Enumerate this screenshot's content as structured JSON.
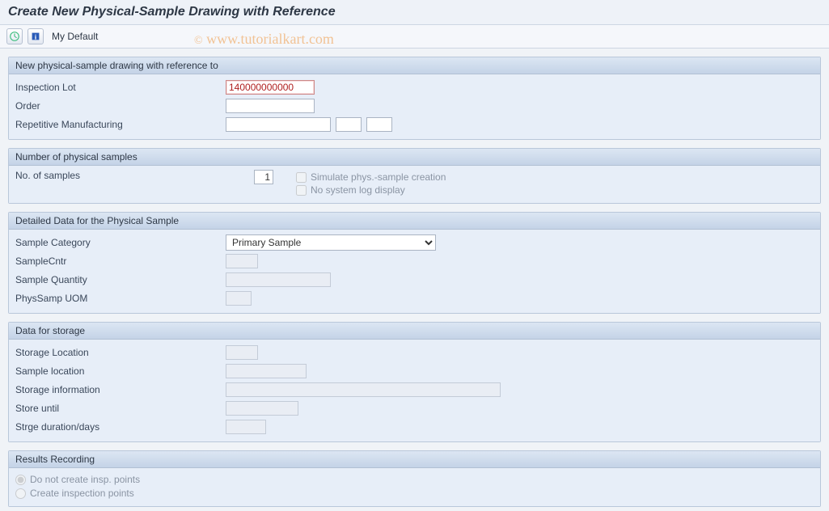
{
  "title": "Create New Physical-Sample Drawing with Reference",
  "toolbar": {
    "my_default": "My Default"
  },
  "watermark": {
    "text": "www.tutorialkart.com",
    "copy": "©"
  },
  "group1": {
    "title": "New physical-sample drawing with reference to",
    "inspection_lot_label": "Inspection Lot",
    "inspection_lot_value": "140000000000",
    "order_label": "Order",
    "order_value": "",
    "rep_mfg_label": "Repetitive Manufacturing",
    "rep_mfg_value1": "",
    "rep_mfg_value2": "",
    "rep_mfg_value3": ""
  },
  "group2": {
    "title": "Number of physical samples",
    "no_samples_label": "No. of samples",
    "no_samples_value": "1",
    "simulate_label": "Simulate phys.-sample creation",
    "no_syslog_label": "No system log display"
  },
  "group3": {
    "title": "Detailed Data for the Physical Sample",
    "sample_category_label": "Sample Category",
    "sample_category_value": "Primary Sample",
    "sample_cntr_label": "SampleCntr",
    "sample_qty_label": "Sample Quantity",
    "phys_samp_uom_label": "PhysSamp UOM"
  },
  "group4": {
    "title": "Data for storage",
    "storage_location_label": "Storage Location",
    "sample_location_label": "Sample location",
    "storage_info_label": "Storage information",
    "store_until_label": "Store until",
    "strge_duration_label": "Strge duration/days"
  },
  "group5": {
    "title": "Results Recording",
    "radio1_label": "Do not create insp. points",
    "radio2_label": "Create inspection points"
  }
}
